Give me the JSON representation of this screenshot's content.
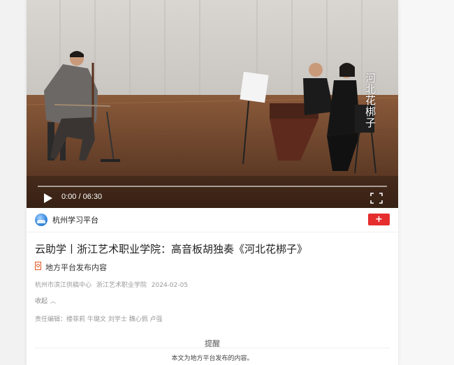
{
  "video": {
    "overlay_title": "河北花梆子",
    "time": "0:00 / 06:30",
    "progress": 0
  },
  "source": {
    "name": "杭州学习平台",
    "subscribe_label": "+"
  },
  "article": {
    "title": "云助学丨浙江艺术职业学院：高音板胡独奏《河北花梆子》",
    "publish_label": "地方平台发布内容",
    "meta": {
      "source": "杭州市滨江供稿中心",
      "org": "浙江艺术职业学院",
      "date": "2024-02-05"
    },
    "collapse_label": "收起",
    "editors": "责任编辑：楼菲莉 牛璐文 刘学士 魏心佩 卢强"
  },
  "notice": {
    "title": "提醒",
    "body": "本文为地方平台发布的内容。"
  },
  "colors": {
    "accent": "#e52e2e",
    "publish_icon": "#e0561f"
  }
}
